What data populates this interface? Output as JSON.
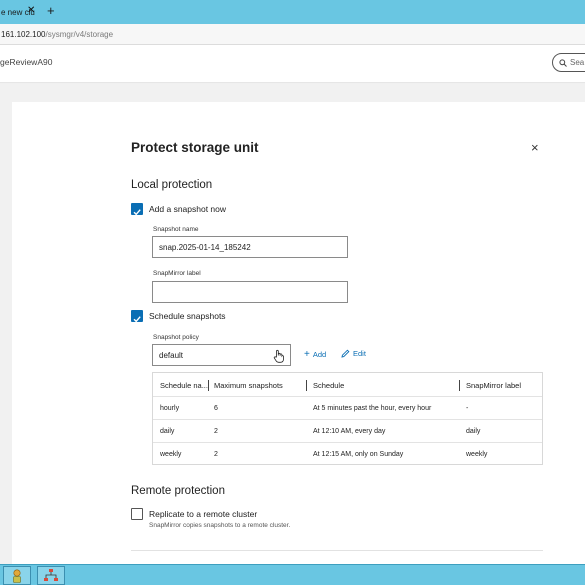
{
  "browser": {
    "tab_title": "e new clu",
    "address_host": "161.102.100",
    "address_path": "/sysmgr/v4/storage"
  },
  "app_header": {
    "cluster_name": "geReviewA90",
    "search_placeholder": "Sea"
  },
  "dialog": {
    "title": "Protect storage unit",
    "close_glyph": "×",
    "local_protection": {
      "heading": "Local protection",
      "add_snapshot_label": "Add a snapshot now",
      "add_snapshot_checked": true,
      "snapshot_name_label": "Snapshot name",
      "snapshot_name_value": "snap.2025-01-14_185242",
      "snapmirror_label_label": "SnapMirror label",
      "snapmirror_label_value": "",
      "schedule_label": "Schedule snapshots",
      "schedule_checked": true,
      "policy_label": "Snapshot policy",
      "policy_value": "default",
      "add_link": "Add",
      "edit_link": "Edit"
    },
    "table": {
      "headers": [
        "Schedule na...",
        "Maximum snapshots",
        "Schedule",
        "SnapMirror label"
      ],
      "rows": [
        [
          "hourly",
          "6",
          "At 5 minutes past the hour, every hour",
          "-"
        ],
        [
          "daily",
          "2",
          "At 12:10 AM, every day",
          "daily"
        ],
        [
          "weekly",
          "2",
          "At 12:15 AM, only on Sunday",
          "weekly"
        ]
      ]
    },
    "remote_protection": {
      "heading": "Remote protection",
      "replicate_label": "Replicate to a remote cluster",
      "replicate_checked": false,
      "replicate_note": "SnapMirror copies snapshots to a remote cluster."
    }
  },
  "colors": {
    "accent": "#0a6eb4",
    "chrome": "#69c6e2"
  }
}
